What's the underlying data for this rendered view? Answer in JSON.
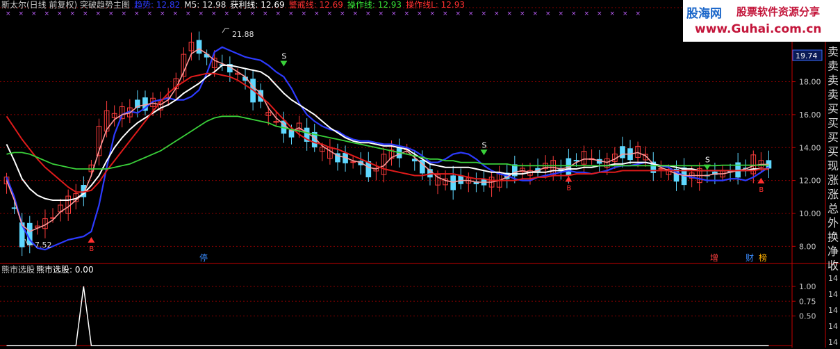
{
  "header": {
    "segments": [
      {
        "text": "斯太尔(日线 前复权) 突破趋势主图",
        "color": "#c8c8c8"
      },
      {
        "text": "趋势: 12.82",
        "color": "#2d3bff"
      },
      {
        "text": "M5: 12.98",
        "color": "#e0e0e0"
      },
      {
        "text": "获利线: 12.69",
        "color": "#ffffff"
      },
      {
        "text": "警戒线: 12.69",
        "color": "#ff3030"
      },
      {
        "text": "操作线: 12.93",
        "color": "#36e036"
      },
      {
        "text": "操作线L: 12.93",
        "color": "#ff3030"
      }
    ]
  },
  "sub_header": {
    "title": "熊市选股",
    "value_text": "熊市选股: 0.00"
  },
  "watermark": {
    "title": "股海网",
    "subtitle": "股票软件资源分享",
    "url": "www.Guhai.com.cn"
  },
  "annotations": {
    "high": "21.88",
    "low": "7.52",
    "current_price": "19.74",
    "sell_marker": "S",
    "buy_marker": "B"
  },
  "bottom_tags": [
    {
      "text": "停",
      "color": "#3a8cff"
    },
    {
      "text": "增",
      "color": "#ff4040"
    },
    {
      "text": "财",
      "color": "#3a8cff"
    },
    {
      "text": "榜",
      "color": "#ffb000"
    }
  ],
  "right_signals": [
    "卖",
    "卖",
    "卖",
    "卖",
    "买",
    "买",
    "买",
    "买",
    "现",
    "涨",
    "涨",
    "总",
    "外",
    "换",
    "净",
    "收"
  ],
  "sub_right_values": [
    "14",
    "14",
    "14",
    "14",
    "14"
  ],
  "colors": {
    "up": "#ff3c3c",
    "down": "#5fd8ff",
    "grid": "#8a0000",
    "axis": "#c80000",
    "trend": "#2d3bff",
    "m5": "#ff9a9a",
    "profit": "#ffffff",
    "warning": "#e01b1b",
    "operate": "#3ad13a"
  },
  "chart_data": [
    {
      "type": "line",
      "title": "",
      "ylim": [
        7.0,
        22.5
      ],
      "y_ticks": [
        "8.00",
        "10.00",
        "12.00",
        "14.00",
        "16.00",
        "18.00"
      ],
      "x_count": 100,
      "series": [
        {
          "name": "趋势",
          "values": [
            12.2,
            11.0,
            9.3,
            8.4,
            7.9,
            7.8,
            8.0,
            8.2,
            8.4,
            8.5,
            8.6,
            8.9,
            10.5,
            12.8,
            14.8,
            16.0,
            16.2,
            16.1,
            16.4,
            16.8,
            16.9,
            17.0,
            16.9,
            16.9,
            17.1,
            17.5,
            18.5,
            19.8,
            20.1,
            19.9,
            19.7,
            19.5,
            19.4,
            19.3,
            19.0,
            18.6,
            18.3,
            17.6,
            16.7,
            16.0,
            15.6,
            15.3,
            15.1,
            15.0,
            14.7,
            14.5,
            14.4,
            14.4,
            14.3,
            14.2,
            14.2,
            14.1,
            14.0,
            13.8,
            13.5,
            13.1,
            13.1,
            13.3,
            13.6,
            13.7,
            13.6,
            13.3,
            12.9,
            12.6,
            12.4,
            12.3,
            12.1,
            12.0,
            12.0,
            12.2,
            12.3,
            12.4,
            12.5,
            12.6,
            12.5,
            12.5,
            12.4,
            12.5,
            12.6,
            12.8,
            12.9,
            12.9,
            13.0,
            13.1,
            13.0,
            12.9,
            12.8,
            12.5,
            12.3,
            12.2,
            12.1,
            12.0,
            12.0,
            12.0,
            12.1,
            12.1,
            12.0,
            12.2,
            12.5,
            12.82
          ]
        },
        {
          "name": "M5",
          "values": [
            12.0,
            10.8,
            9.3,
            8.9,
            9.1,
            9.3,
            9.6,
            10.1,
            10.4,
            10.8,
            11.2,
            12.3,
            13.8,
            15.1,
            15.7,
            16.0,
            16.1,
            16.5,
            16.6,
            16.7,
            16.6,
            16.9,
            17.6,
            18.6,
            19.7,
            20.0,
            19.7,
            19.3,
            19.1,
            18.9,
            18.6,
            18.3,
            17.7,
            17.3,
            16.4,
            15.8,
            15.4,
            15.0,
            15.2,
            14.9,
            14.6,
            14.1,
            13.8,
            13.5,
            13.4,
            13.2,
            13.1,
            12.8,
            12.7,
            12.9,
            13.4,
            13.6,
            13.8,
            13.4,
            13.0,
            12.6,
            12.2,
            12.0,
            11.9,
            12.0,
            12.0,
            11.9,
            11.9,
            11.9,
            12.0,
            12.2,
            12.5,
            12.6,
            12.5,
            12.6,
            12.8,
            12.8,
            12.7,
            12.8,
            13.1,
            13.3,
            13.3,
            13.2,
            13.1,
            13.3,
            13.6,
            13.6,
            13.7,
            13.5,
            13.0,
            12.8,
            12.6,
            12.4,
            12.3,
            12.3,
            12.3,
            12.3,
            12.4,
            12.4,
            12.5,
            12.6,
            12.7,
            12.9,
            12.98,
            12.98
          ]
        },
        {
          "name": "获利线",
          "values": [
            14.2,
            13.2,
            12.1,
            11.5,
            11.1,
            10.9,
            10.8,
            10.8,
            10.8,
            10.9,
            11.2,
            11.7,
            12.3,
            13.2,
            14.0,
            14.6,
            15.1,
            15.5,
            15.8,
            16.1,
            16.4,
            16.6,
            16.9,
            17.3,
            17.6,
            17.9,
            18.3,
            18.6,
            19.0,
            19.0,
            18.9,
            18.8,
            18.7,
            18.6,
            18.3,
            17.8,
            17.3,
            16.9,
            16.6,
            16.3,
            16.0,
            15.6,
            15.2,
            14.9,
            14.6,
            14.4,
            14.3,
            14.3,
            14.2,
            14.1,
            14.1,
            14.0,
            13.9,
            13.6,
            13.3,
            13.0,
            12.9,
            12.8,
            12.8,
            12.8,
            12.8,
            12.7,
            12.6,
            12.5,
            12.5,
            12.4,
            12.4,
            12.4,
            12.5,
            12.5,
            12.5,
            12.6,
            12.6,
            12.7,
            12.7,
            12.8,
            12.8,
            12.9,
            12.9,
            13.0,
            13.0,
            13.1,
            13.1,
            13.1,
            13.0,
            12.9,
            12.9,
            12.8,
            12.7,
            12.7,
            12.6,
            12.6,
            12.6,
            12.6,
            12.6,
            12.6,
            12.6,
            12.7,
            12.69,
            12.69
          ]
        },
        {
          "name": "警戒线",
          "values": [
            15.9,
            15.2,
            14.5,
            13.9,
            13.3,
            12.8,
            12.4,
            12.0,
            11.6,
            11.3,
            11.3,
            11.4,
            11.9,
            12.6,
            13.2,
            13.8,
            14.4,
            15.0,
            15.6,
            16.2,
            16.8,
            17.3,
            17.7,
            18.0,
            18.3,
            18.4,
            18.5,
            18.5,
            18.4,
            18.3,
            18.1,
            17.8,
            17.5,
            17.1,
            16.7,
            16.2,
            15.7,
            15.2,
            14.8,
            14.5,
            14.3,
            14.2,
            14.0,
            13.9,
            13.7,
            13.5,
            13.3,
            13.1,
            12.9,
            12.7,
            12.6,
            12.5,
            12.4,
            12.3,
            12.3,
            12.4,
            12.4,
            12.4,
            12.4,
            12.3,
            12.2,
            12.1,
            12.1,
            12.0,
            12.0,
            12.0,
            12.0,
            12.1,
            12.1,
            12.2,
            12.2,
            12.3,
            12.3,
            12.3,
            12.4,
            12.4,
            12.4,
            12.5,
            12.5,
            12.5,
            12.6,
            12.6,
            12.6,
            12.6,
            12.6,
            12.6,
            12.6,
            12.6,
            12.6,
            12.6,
            12.6,
            12.6,
            12.6,
            12.6,
            12.6,
            12.6,
            12.6,
            12.6,
            12.69,
            12.69
          ]
        },
        {
          "name": "操作线",
          "values": [
            13.6,
            13.7,
            13.7,
            13.6,
            13.4,
            13.2,
            13.0,
            12.9,
            12.8,
            12.7,
            12.7,
            12.7,
            12.7,
            12.7,
            12.8,
            12.9,
            13.0,
            13.2,
            13.4,
            13.6,
            13.8,
            14.1,
            14.4,
            14.7,
            15.0,
            15.3,
            15.6,
            15.8,
            15.9,
            15.9,
            15.9,
            15.8,
            15.7,
            15.6,
            15.5,
            15.3,
            15.2,
            15.1,
            15.0,
            14.9,
            14.8,
            14.7,
            14.6,
            14.5,
            14.4,
            14.3,
            14.2,
            14.1,
            14.0,
            13.9,
            13.8,
            13.7,
            13.6,
            13.5,
            13.4,
            13.3,
            13.3,
            13.2,
            13.2,
            13.1,
            13.1,
            13.1,
            13.0,
            13.0,
            13.0,
            13.0,
            12.9,
            12.9,
            12.9,
            12.9,
            12.9,
            12.9,
            12.9,
            12.9,
            12.9,
            12.9,
            12.9,
            12.9,
            12.9,
            12.9,
            12.9,
            12.9,
            12.9,
            12.9,
            12.9,
            12.9,
            12.9,
            12.9,
            12.9,
            12.9,
            12.9,
            12.9,
            12.9,
            12.93,
            12.93,
            12.93,
            12.93,
            12.93,
            12.93,
            12.93
          ]
        }
      ]
    },
    {
      "type": "line",
      "title": "",
      "ylim": [
        0,
        1.2
      ],
      "y_ticks": [
        "0.50",
        "0.75",
        "1.00"
      ],
      "x_count": 100,
      "series": [
        {
          "name": "熊市选股",
          "values": [
            0,
            0,
            0,
            0,
            0,
            0,
            0,
            0,
            0,
            0,
            1,
            0,
            0,
            0,
            0,
            0,
            0,
            0,
            0,
            0,
            0,
            0,
            0,
            0,
            0,
            0,
            0,
            0,
            0,
            0,
            0,
            0,
            0,
            0,
            0,
            0,
            0,
            0,
            0,
            0,
            0,
            0,
            0,
            0,
            0,
            0,
            0,
            0,
            0,
            0,
            0,
            0,
            0,
            0,
            0,
            0,
            0,
            0,
            0,
            0,
            0,
            0,
            0,
            0,
            0,
            0,
            0,
            0,
            0,
            0,
            0,
            0,
            0,
            0,
            0,
            0,
            0,
            0,
            0,
            0,
            0,
            0,
            0,
            0,
            0,
            0,
            0,
            0,
            0,
            0,
            0,
            0,
            0,
            0,
            0,
            0,
            0,
            0,
            0,
            0
          ]
        }
      ]
    }
  ]
}
